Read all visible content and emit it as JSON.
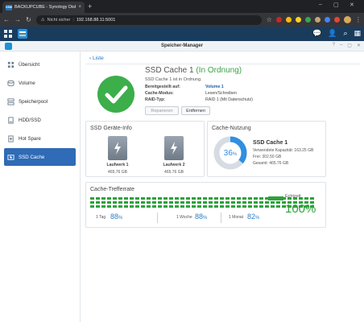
{
  "browser": {
    "tab_title": "BACKUPCUBE - Synology DiskSt",
    "tab_favicon": "DSM",
    "tab_close": "×",
    "new_tab": "+",
    "not_secure": "Nicht sicher",
    "url": "192.168.88.11:5001",
    "window_controls": [
      "–",
      "▢",
      "✕"
    ]
  },
  "dsm_topbar": {
    "icons": [
      "grid-icon",
      "storage-manager-taskbar-icon"
    ],
    "right_icons": [
      "chat-icon",
      "user-icon",
      "search-icon",
      "widgets-icon"
    ]
  },
  "app": {
    "title": "Speicher-Manager",
    "controls": [
      "?",
      "–",
      "▢",
      "✕"
    ]
  },
  "sidebar": {
    "items": [
      {
        "label": "Übersicht",
        "icon": "overview-icon",
        "active": false
      },
      {
        "label": "Volume",
        "icon": "volume-icon",
        "active": false
      },
      {
        "label": "Speicherpool",
        "icon": "storage-pool-icon",
        "active": false
      },
      {
        "label": "HDD/SSD",
        "icon": "hdd-icon",
        "active": false
      },
      {
        "label": "Hot Spare",
        "icon": "hot-spare-icon",
        "active": false
      },
      {
        "label": "SSD Cache",
        "icon": "ssd-cache-icon",
        "active": true
      }
    ]
  },
  "main": {
    "back_label": "Liste",
    "cache_name": "SSD Cache 1",
    "status": "In Ordnung",
    "status_sentence": "SSD Cache 1 ist in Ordnung.",
    "properties": [
      {
        "key": "Bereitgestellt auf:",
        "value": "Volume 1",
        "link": true
      },
      {
        "key": "Cache-Modus:",
        "value": "Lesen/Schreiben",
        "link": false
      },
      {
        "key": "RAID-Typ:",
        "value": "RAID 1 (Mit Datenschutz)",
        "link": false
      }
    ],
    "buttons": {
      "repair": "Reparieren",
      "remove": "Entfernen"
    }
  },
  "ssd_info": {
    "title": "SSD Geräte-Info",
    "drives": [
      {
        "name": "Laufwerk 1",
        "size": "465.76 GB"
      },
      {
        "name": "Laufwerk 2",
        "size": "465.76 GB"
      }
    ]
  },
  "cache_usage": {
    "title": "Cache-Nutzung",
    "percent": 36,
    "percent_label": "36",
    "percent_sign": "%",
    "name": "SSD Cache 1",
    "used": "Verwendete Kapazität: 163.25 GB",
    "free": "Frei: 302.50 GB",
    "total": "Gesamt: 465.76 GB"
  },
  "hit_rate": {
    "title": "Cache-Trefferrate",
    "periods": [
      {
        "label": "1 Tag",
        "value": "88",
        "unit": "%"
      },
      {
        "label": "1 Woche",
        "value": "88",
        "unit": "%"
      },
      {
        "label": "1 Monat",
        "value": "82",
        "unit": "%"
      }
    ],
    "realtime_label": "Echtzeit",
    "realtime_value": "100%"
  },
  "colors": {
    "accent": "#2f6bb6",
    "ok_green": "#3aa246",
    "hit_green": "#2ca33b",
    "pct_blue": "#2e7fc8",
    "donut_blue": "#2f8fe0"
  }
}
